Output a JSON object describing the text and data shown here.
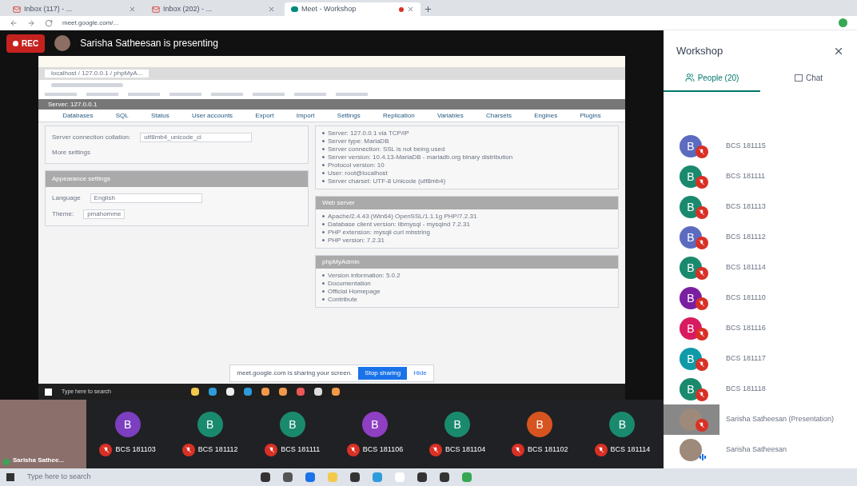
{
  "browser": {
    "tabs": [
      {
        "title": "Inbox (117) - ...",
        "kind": "mail",
        "selected": false
      },
      {
        "title": "Inbox (202) - ...",
        "kind": "mail",
        "selected": false
      },
      {
        "title": "Meet - Workshop",
        "kind": "meet",
        "selected": true
      }
    ],
    "url": "meet.google.com/..."
  },
  "meet": {
    "rec": "REC",
    "presenting": "Sarisha Satheesan is presenting",
    "shared_screen": {
      "tab": "localhost / 127.0.0.1 / phpMyA...",
      "server": "Server: 127.0.0.1",
      "nav": [
        "Databases",
        "SQL",
        "Status",
        "User accounts",
        "Export",
        "Import",
        "Settings",
        "Replication",
        "Variables",
        "Charsets",
        "Engines",
        "Plugins"
      ],
      "collation_label": "Server connection collation:",
      "collation_value": "utf8mb4_unicode_ci",
      "more_settings": "More settings",
      "appearance_title": "Appearance settings",
      "language_label": "Language",
      "language_value": "English",
      "theme_label": "Theme:",
      "theme_value": "pmahomme",
      "db_items": [
        "Server: 127.0.0.1 via TCP/IP",
        "Server type: MariaDB",
        "Server connection: SSL is not being used",
        "Server version: 10.4.13-MariaDB - mariadb.org binary distribution",
        "Protocol version: 10",
        "User: root@localhost",
        "Server charset: UTF-8 Unicode (utf8mb4)"
      ],
      "web_title": "Web server",
      "web_items": [
        "Apache/2.4.43 (Win64) OpenSSL/1.1.1g PHP/7.2.31",
        "Database client version: libmysql - mysqlnd 7.2.31",
        "PHP extension: mysqli curl mbstring",
        "PHP version: 7.2.31"
      ],
      "pma_title": "phpMyAdmin",
      "pma_items": [
        "Version information: 5.0.2",
        "Documentation",
        "Official Homepage",
        "Contribute"
      ],
      "share_notice": "meet.google.com is sharing your screen.",
      "stop_sharing": "Stop sharing",
      "hide": "Hide",
      "taskbar_search": "Type here to search"
    },
    "self_name": "Sarisha Sathee...",
    "tiles": [
      {
        "initial": "B",
        "name": "BCS 181103",
        "color": "#7b3fbf"
      },
      {
        "initial": "B",
        "name": "BCS 181112",
        "color": "#1a8a6e"
      },
      {
        "initial": "B",
        "name": "BCS 181111",
        "color": "#1a8a6e"
      },
      {
        "initial": "B",
        "name": "BCS 181106",
        "color": "#8e3fc2"
      },
      {
        "initial": "B",
        "name": "BCS 181104",
        "color": "#1a8a6e"
      },
      {
        "initial": "B",
        "name": "BCS 181102",
        "color": "#d6541f"
      },
      {
        "initial": "B",
        "name": "BCS 181114",
        "color": "#1a8a6e"
      }
    ]
  },
  "panel": {
    "title": "Workshop",
    "tabs": [
      {
        "label": "People (20)",
        "kind": "people",
        "selected": true
      },
      {
        "label": "Chat",
        "kind": "chat",
        "selected": false
      }
    ],
    "people": [
      {
        "initial": "B",
        "name": "BCS 181115",
        "color": "#5c6bc0",
        "muted": true,
        "kind": "student"
      },
      {
        "initial": "B",
        "name": "BCS 181111",
        "color": "#1a8a6e",
        "muted": true,
        "kind": "student"
      },
      {
        "initial": "B",
        "name": "BCS 181113",
        "color": "#1a8a6e",
        "muted": true,
        "kind": "student"
      },
      {
        "initial": "B",
        "name": "BCS 181112",
        "color": "#5c6bc0",
        "muted": true,
        "kind": "student"
      },
      {
        "initial": "B",
        "name": "BCS 181114",
        "color": "#1a8a6e",
        "muted": true,
        "kind": "student"
      },
      {
        "initial": "B",
        "name": "BCS 181110",
        "color": "#7b1fa2",
        "muted": true,
        "kind": "student"
      },
      {
        "initial": "B",
        "name": "BCS 181116",
        "color": "#d81b60",
        "muted": true,
        "kind": "student"
      },
      {
        "initial": "B",
        "name": "BCS 181117",
        "color": "#0f9aa8",
        "muted": true,
        "kind": "student"
      },
      {
        "initial": "B",
        "name": "BCS 181118",
        "color": "#1a8a6e",
        "muted": true,
        "kind": "student"
      },
      {
        "name": "Sarisha Satheesan (Presentation)",
        "muted": true,
        "kind": "presentation"
      },
      {
        "name": "Sarisha Satheesan",
        "muted": false,
        "kind": "photo"
      }
    ]
  },
  "taskbar": {
    "search": "Type here to search"
  }
}
